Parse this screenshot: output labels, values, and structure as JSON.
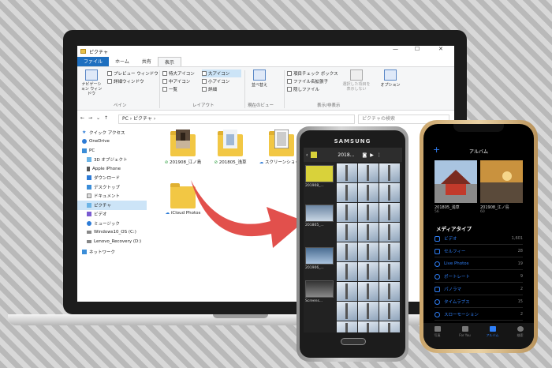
{
  "colors": {
    "accent": "#2f7ff7",
    "file_tab": "#1e6fbf",
    "arrow": "#e2504c"
  },
  "explorer": {
    "window_title": "ピクチャ",
    "tabs": [
      "ファイル",
      "ホーム",
      "共有",
      "表示"
    ],
    "ribbon": {
      "nav_pane": "ナビゲーション ウィンドウ",
      "preview_pane": "プレビュー ウィンドウ",
      "details_pane": "詳細ウィンドウ",
      "pane_group": "ペイン",
      "layout_options": [
        "特大アイコン",
        "大アイコン",
        "中アイコン",
        "小アイコン",
        "一覧",
        "詳細"
      ],
      "layout_group": "レイアウト",
      "sort": "並べ替え",
      "current_view_group": "現在のビュー",
      "checkboxes": [
        "項目チェック ボックス",
        "ファイル名拡張子",
        "隠しファイル"
      ],
      "hide_selected": "選択した項目を表示しない",
      "show_hide_group": "表示/非表示",
      "options": "オプション"
    },
    "address": "PC › ピクチャ ›",
    "search_placeholder": "ピクチャの検索",
    "nav_items": [
      {
        "label": "クイック アクセス",
        "icon": "star-icon"
      },
      {
        "label": "OneDrive",
        "icon": "cloud-icon"
      },
      {
        "label": "PC",
        "icon": "computer-icon"
      },
      {
        "label": "3D オブジェクト",
        "icon": "cube-icon"
      },
      {
        "label": "Apple iPhone",
        "icon": "phone-icon"
      },
      {
        "label": "ダウンロード",
        "icon": "download-icon"
      },
      {
        "label": "デスクトップ",
        "icon": "desktop-icon"
      },
      {
        "label": "ドキュメント",
        "icon": "document-icon"
      },
      {
        "label": "ピクチャ",
        "icon": "pictures-icon"
      },
      {
        "label": "ビデオ",
        "icon": "video-icon"
      },
      {
        "label": "ミュージック",
        "icon": "music-icon"
      },
      {
        "label": "Windows10_OS (C:)",
        "icon": "drive-icon"
      },
      {
        "label": "Lenovo_Recovery (D:)",
        "icon": "drive-icon"
      },
      {
        "label": "ネットワーク",
        "icon": "network-icon"
      }
    ],
    "folders": [
      "201908_江ノ島",
      "201805_浅草",
      "スクリーンショット",
      "iCloud Photos"
    ]
  },
  "samsung": {
    "brand": "SAMSUNG",
    "header": "2018...",
    "albums": [
      "201908_...",
      "201805_...",
      "201906_...",
      "Screens..."
    ]
  },
  "iphone": {
    "title": "アルバム",
    "albums": [
      {
        "name": "201805_浅草",
        "count": "56"
      },
      {
        "name": "201908_江ノ島",
        "count": "60"
      }
    ],
    "section": "メディアタイプ",
    "media_types": [
      {
        "label": "ビデオ",
        "count": "1,601"
      },
      {
        "label": "セルフィー",
        "count": "28"
      },
      {
        "label": "Live Photos",
        "count": "19"
      },
      {
        "label": "ポートレート",
        "count": "9"
      },
      {
        "label": "パノラマ",
        "count": "2"
      },
      {
        "label": "タイムラプス",
        "count": "15"
      },
      {
        "label": "スローモーション",
        "count": "2"
      }
    ],
    "tabs": [
      "写真",
      "For You",
      "アルバム",
      "検索"
    ]
  }
}
